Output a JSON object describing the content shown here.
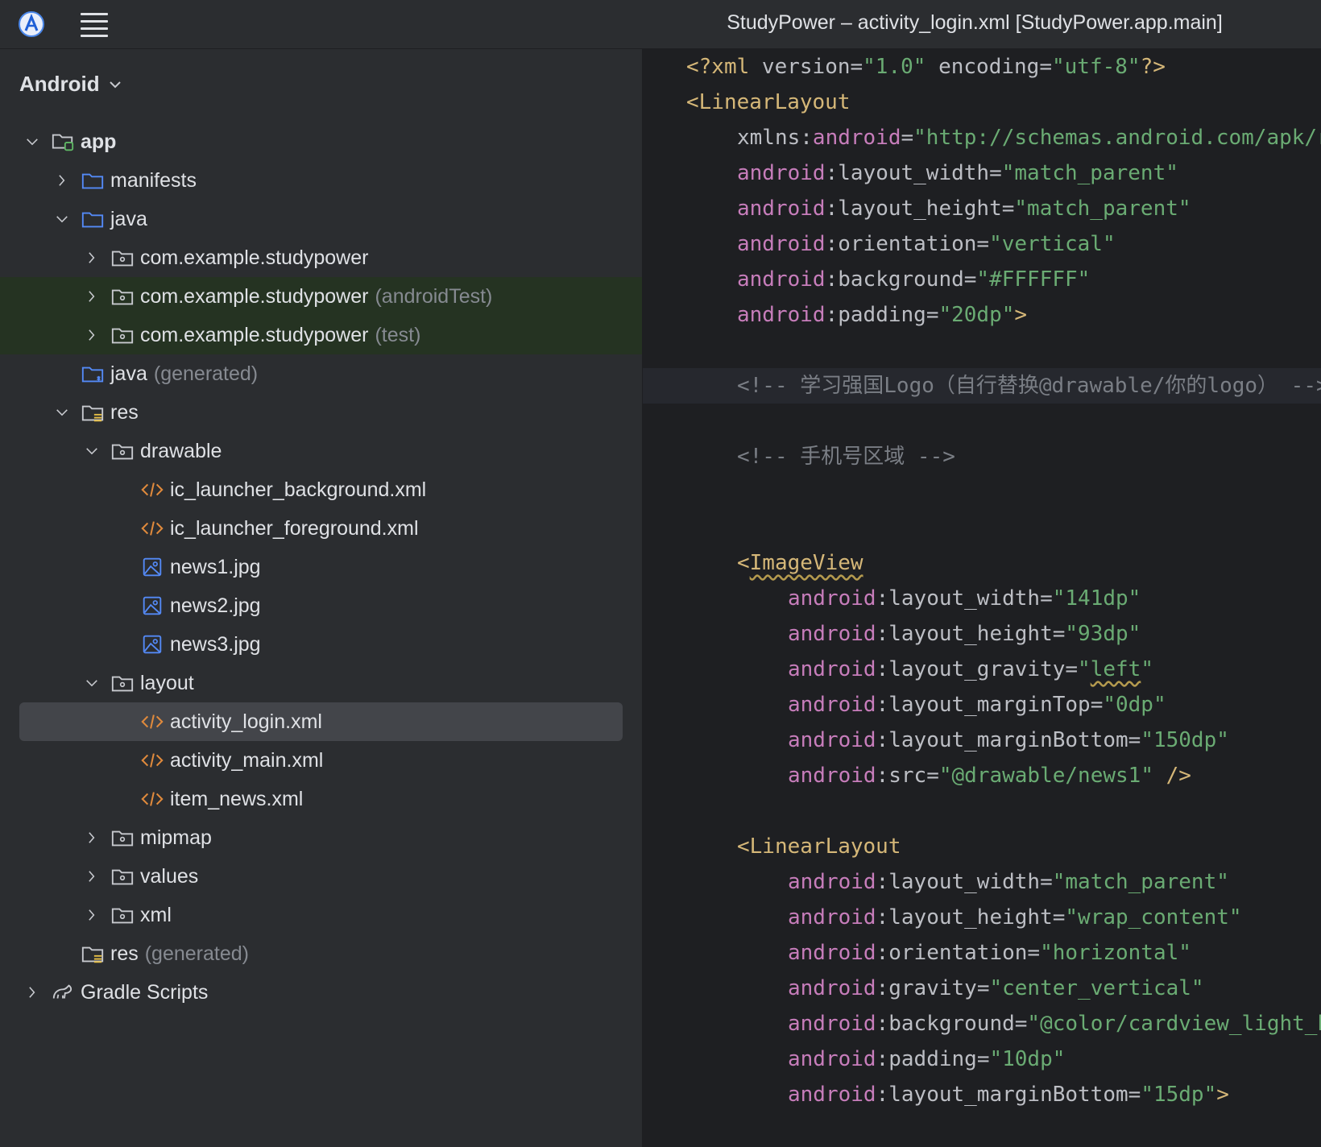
{
  "titlebar": {
    "title": "StudyPower – activity_login.xml [StudyPower.app.main]"
  },
  "project_panel": {
    "view_label": "Android",
    "tree": [
      {
        "label": "app",
        "hint": "",
        "depth": 0,
        "arrow": "down",
        "icon": "module-folder-icon",
        "bold": true
      },
      {
        "label": "manifests",
        "hint": "",
        "depth": 1,
        "arrow": "right",
        "icon": "folder-icon"
      },
      {
        "label": "java",
        "hint": "",
        "depth": 1,
        "arrow": "down",
        "icon": "folder-icon"
      },
      {
        "label": "com.example.studypower",
        "hint": "",
        "depth": 2,
        "arrow": "right",
        "icon": "package-icon"
      },
      {
        "label": "com.example.studypower",
        "hint": "(androidTest)",
        "depth": 2,
        "arrow": "right",
        "icon": "package-icon",
        "green": true
      },
      {
        "label": "com.example.studypower",
        "hint": "(test)",
        "depth": 2,
        "arrow": "right",
        "icon": "package-icon",
        "green": true
      },
      {
        "label": "java",
        "hint": "(generated)",
        "depth": 1,
        "arrow": "none",
        "icon": "generated-folder-icon"
      },
      {
        "label": "res",
        "hint": "",
        "depth": 1,
        "arrow": "down",
        "icon": "resource-folder-icon"
      },
      {
        "label": "drawable",
        "hint": "",
        "depth": 2,
        "arrow": "down",
        "icon": "package-icon"
      },
      {
        "label": "ic_launcher_background.xml",
        "hint": "",
        "depth": 3,
        "arrow": "none",
        "icon": "xml-file-icon"
      },
      {
        "label": "ic_launcher_foreground.xml",
        "hint": "",
        "depth": 3,
        "arrow": "none",
        "icon": "xml-file-icon"
      },
      {
        "label": "news1.jpg",
        "hint": "",
        "depth": 3,
        "arrow": "none",
        "icon": "image-file-icon"
      },
      {
        "label": "news2.jpg",
        "hint": "",
        "depth": 3,
        "arrow": "none",
        "icon": "image-file-icon"
      },
      {
        "label": "news3.jpg",
        "hint": "",
        "depth": 3,
        "arrow": "none",
        "icon": "image-file-icon"
      },
      {
        "label": "layout",
        "hint": "",
        "depth": 2,
        "arrow": "down",
        "icon": "package-icon"
      },
      {
        "label": "activity_login.xml",
        "hint": "",
        "depth": 3,
        "arrow": "none",
        "icon": "xml-file-icon",
        "selected": true
      },
      {
        "label": "activity_main.xml",
        "hint": "",
        "depth": 3,
        "arrow": "none",
        "icon": "xml-file-icon"
      },
      {
        "label": "item_news.xml",
        "hint": "",
        "depth": 3,
        "arrow": "none",
        "icon": "xml-file-icon"
      },
      {
        "label": "mipmap",
        "hint": "",
        "depth": 2,
        "arrow": "right",
        "icon": "package-icon"
      },
      {
        "label": "values",
        "hint": "",
        "depth": 2,
        "arrow": "right",
        "icon": "package-icon"
      },
      {
        "label": "xml",
        "hint": "",
        "depth": 2,
        "arrow": "right",
        "icon": "package-icon"
      },
      {
        "label": "res",
        "hint": "(generated)",
        "depth": 1,
        "arrow": "none",
        "icon": "resource-folder-icon"
      },
      {
        "label": "Gradle Scripts",
        "hint": "",
        "depth": 0,
        "arrow": "right",
        "icon": "gradle-icon"
      }
    ]
  },
  "editor": {
    "lines": [
      {
        "row": 0,
        "indent": 0,
        "hl": false,
        "tokens": [
          [
            "tg",
            "<?xml "
          ],
          [
            "pl",
            "version"
          ],
          [
            "pl",
            "="
          ],
          [
            "vl",
            "\"1.0\""
          ],
          [
            "pl",
            " encoding"
          ],
          [
            "pl",
            "="
          ],
          [
            "vl",
            "\"utf-8\""
          ],
          [
            "tg",
            "?>"
          ]
        ]
      },
      {
        "row": 1,
        "indent": 0,
        "hl": false,
        "tokens": [
          [
            "tg",
            "<LinearLayout"
          ]
        ]
      },
      {
        "row": 2,
        "indent": 1,
        "hl": false,
        "tokens": [
          [
            "pl",
            "xmlns:"
          ],
          [
            "at",
            "android"
          ],
          [
            "pl",
            "="
          ],
          [
            "vl",
            "\"http://schemas.android.com/apk/res/android\""
          ]
        ]
      },
      {
        "row": 3,
        "indent": 1,
        "hl": false,
        "tokens": [
          [
            "at",
            "android"
          ],
          [
            "pl",
            ":layout_width"
          ],
          [
            "pl",
            "="
          ],
          [
            "vl",
            "\"match_parent\""
          ]
        ]
      },
      {
        "row": 4,
        "indent": 1,
        "hl": false,
        "tokens": [
          [
            "at",
            "android"
          ],
          [
            "pl",
            ":layout_height"
          ],
          [
            "pl",
            "="
          ],
          [
            "vl",
            "\"match_parent\""
          ]
        ]
      },
      {
        "row": 5,
        "indent": 1,
        "hl": false,
        "tokens": [
          [
            "at",
            "android"
          ],
          [
            "pl",
            ":orientation"
          ],
          [
            "pl",
            "="
          ],
          [
            "vl",
            "\"vertical\""
          ]
        ]
      },
      {
        "row": 6,
        "indent": 1,
        "hl": false,
        "tokens": [
          [
            "at",
            "android"
          ],
          [
            "pl",
            ":background"
          ],
          [
            "pl",
            "="
          ],
          [
            "vl",
            "\"#FFFFFF\""
          ]
        ]
      },
      {
        "row": 7,
        "indent": 1,
        "hl": false,
        "tokens": [
          [
            "at",
            "android"
          ],
          [
            "pl",
            ":padding"
          ],
          [
            "pl",
            "="
          ],
          [
            "vl",
            "\"20dp\""
          ],
          [
            "tg",
            ">"
          ]
        ]
      },
      {
        "row": 9,
        "indent": 1,
        "hl": true,
        "tokens": [
          [
            "cm",
            "<!-- 学习强国Logo（自行替换@drawable/你的logo） -->"
          ]
        ]
      },
      {
        "row": 11,
        "indent": 1,
        "hl": false,
        "tokens": [
          [
            "cm",
            "<!-- 手机号区域 -->"
          ]
        ]
      },
      {
        "row": 14,
        "indent": 1,
        "hl": false,
        "tokens": [
          [
            "tg",
            "<"
          ],
          [
            "tg wavy",
            "ImageView"
          ]
        ]
      },
      {
        "row": 15,
        "indent": 2,
        "hl": false,
        "tokens": [
          [
            "at",
            "android"
          ],
          [
            "pl",
            ":layout_width"
          ],
          [
            "pl",
            "="
          ],
          [
            "vl",
            "\"141dp\""
          ]
        ]
      },
      {
        "row": 16,
        "indent": 2,
        "hl": false,
        "tokens": [
          [
            "at",
            "android"
          ],
          [
            "pl",
            ":layout_height"
          ],
          [
            "pl",
            "="
          ],
          [
            "vl",
            "\"93dp\""
          ]
        ]
      },
      {
        "row": 17,
        "indent": 2,
        "hl": false,
        "tokens": [
          [
            "at",
            "android"
          ],
          [
            "pl",
            ":layout_gravity"
          ],
          [
            "pl",
            "="
          ],
          [
            "vl",
            "\""
          ],
          [
            "vl wavy",
            "left"
          ],
          [
            "vl",
            "\""
          ]
        ]
      },
      {
        "row": 18,
        "indent": 2,
        "hl": false,
        "tokens": [
          [
            "at",
            "android"
          ],
          [
            "pl",
            ":layout_marginTop"
          ],
          [
            "pl",
            "="
          ],
          [
            "vl",
            "\"0dp\""
          ]
        ]
      },
      {
        "row": 19,
        "indent": 2,
        "hl": false,
        "tokens": [
          [
            "at",
            "android"
          ],
          [
            "pl",
            ":layout_marginBottom"
          ],
          [
            "pl",
            "="
          ],
          [
            "vl",
            "\"150dp\""
          ]
        ]
      },
      {
        "row": 20,
        "indent": 2,
        "hl": false,
        "tokens": [
          [
            "at",
            "android"
          ],
          [
            "pl",
            ":src"
          ],
          [
            "pl",
            "="
          ],
          [
            "vl",
            "\"@drawable/news1\""
          ],
          [
            "tg",
            " />"
          ]
        ]
      },
      {
        "row": 22,
        "indent": 1,
        "hl": false,
        "tokens": [
          [
            "tg",
            "<LinearLayout"
          ]
        ]
      },
      {
        "row": 23,
        "indent": 2,
        "hl": false,
        "tokens": [
          [
            "at",
            "android"
          ],
          [
            "pl",
            ":layout_width"
          ],
          [
            "pl",
            "="
          ],
          [
            "vl",
            "\"match_parent\""
          ]
        ]
      },
      {
        "row": 24,
        "indent": 2,
        "hl": false,
        "tokens": [
          [
            "at",
            "android"
          ],
          [
            "pl",
            ":layout_height"
          ],
          [
            "pl",
            "="
          ],
          [
            "vl",
            "\"wrap_content\""
          ]
        ]
      },
      {
        "row": 25,
        "indent": 2,
        "hl": false,
        "tokens": [
          [
            "at",
            "android"
          ],
          [
            "pl",
            ":orientation"
          ],
          [
            "pl",
            "="
          ],
          [
            "vl",
            "\"horizontal\""
          ]
        ]
      },
      {
        "row": 26,
        "indent": 2,
        "hl": false,
        "tokens": [
          [
            "at",
            "android"
          ],
          [
            "pl",
            ":gravity"
          ],
          [
            "pl",
            "="
          ],
          [
            "vl",
            "\"center_vertical\""
          ]
        ]
      },
      {
        "row": 27,
        "indent": 2,
        "hl": false,
        "tokens": [
          [
            "at",
            "android"
          ],
          [
            "pl",
            ":background"
          ],
          [
            "pl",
            "="
          ],
          [
            "vl",
            "\"@color/cardview_light_background\""
          ]
        ]
      },
      {
        "row": 28,
        "indent": 2,
        "hl": false,
        "tokens": [
          [
            "at",
            "android"
          ],
          [
            "pl",
            ":padding"
          ],
          [
            "pl",
            "="
          ],
          [
            "vl",
            "\"10dp\""
          ]
        ]
      },
      {
        "row": 29,
        "indent": 2,
        "hl": false,
        "tokens": [
          [
            "at",
            "android"
          ],
          [
            "pl",
            ":layout_marginBottom"
          ],
          [
            "pl",
            "="
          ],
          [
            "vl",
            "\"15dp\""
          ],
          [
            "tg",
            ">"
          ]
        ]
      }
    ]
  },
  "colors": {
    "background": "#2b2d30",
    "editor_background": "#1e1f22",
    "selection": "#43454a",
    "test_source_highlight": "#253322",
    "xml_tag": "#d5b778",
    "xml_attr_namespace": "#c77dbb",
    "xml_value": "#6aab73",
    "comment": "#7a7e85"
  }
}
